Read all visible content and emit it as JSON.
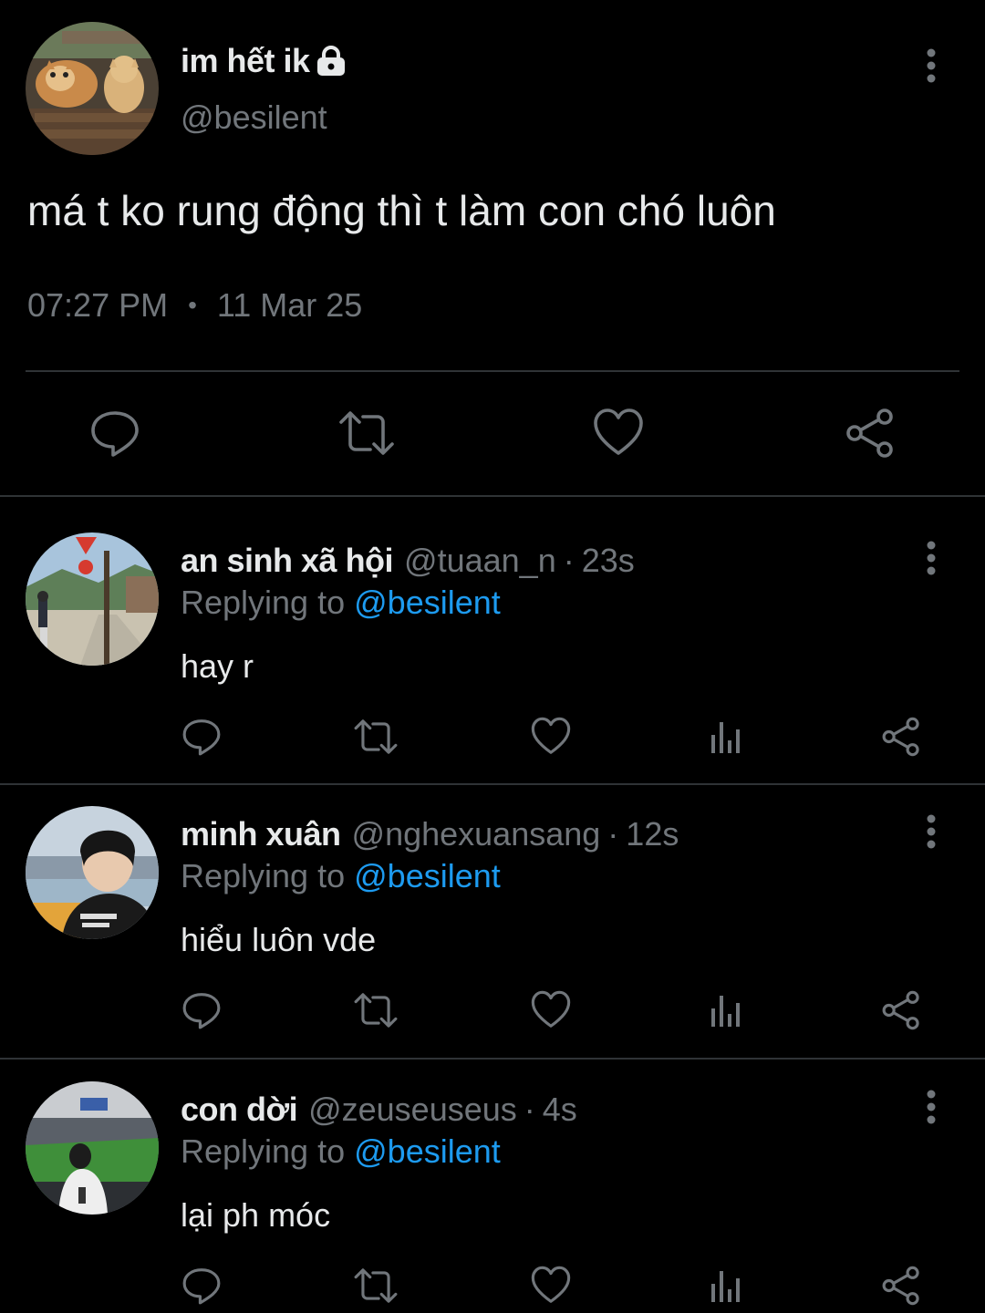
{
  "main_tweet": {
    "display_name": "im hết ik",
    "handle": "@besilent",
    "text": "má t ko rung động thì t làm con chó luôn",
    "time": "07:27 PM",
    "separator": "•",
    "date": "11 Mar 25",
    "icons": [
      "lock-icon",
      "more-vertical-icon",
      "reply-icon",
      "retweet-icon",
      "like-icon",
      "share-icon"
    ]
  },
  "replies": [
    {
      "display_name": "an sinh xã hội",
      "handle": "@tuaan_n",
      "separator": "·",
      "time": "23s",
      "replying_prefix": "Replying to",
      "replying_to": "@besilent",
      "text": "hay r"
    },
    {
      "display_name": "minh xuân",
      "handle": "@nghexuansang",
      "separator": "·",
      "time": "12s",
      "replying_prefix": "Replying to",
      "replying_to": "@besilent",
      "text": "hiểu luôn vde"
    },
    {
      "display_name": "con dời",
      "handle": "@zeuseuseus",
      "separator": "·",
      "time": "4s",
      "replying_prefix": "Replying to",
      "replying_to": "@besilent",
      "text": "lại ph móc"
    }
  ],
  "colors": {
    "background": "#000000",
    "primary_text": "#e7e9ea",
    "secondary_text": "#71767b",
    "mention": "#1d9bf0",
    "divider": "#2f3336"
  }
}
